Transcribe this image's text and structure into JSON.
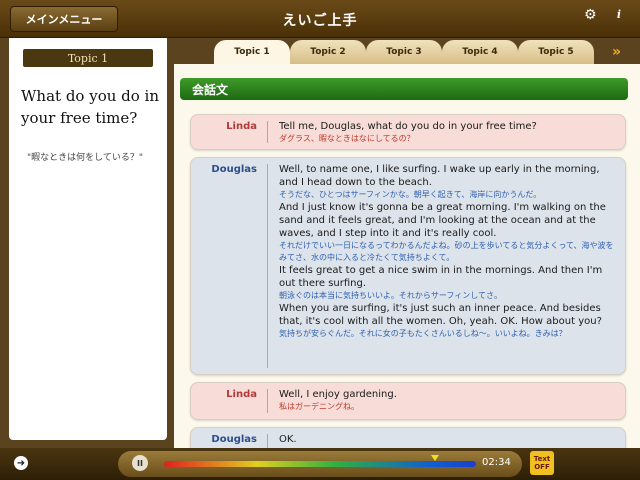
{
  "header": {
    "menu_label": "メインメニュー",
    "app_title": "えいご上手"
  },
  "topic": {
    "label": "Topic 1",
    "question": "What do you do in your free time?",
    "translation": "\"暇なときは何をしている？\""
  },
  "tabs": [
    {
      "label": "Topic 1",
      "active": true
    },
    {
      "label": "Topic 2",
      "active": false
    },
    {
      "label": "Topic 3",
      "active": false
    },
    {
      "label": "Topic 4",
      "active": false
    },
    {
      "label": "Topic 5",
      "active": false
    }
  ],
  "tabs_next_label": "»",
  "section_title": "会話文",
  "dialogue": [
    {
      "speaker": "Linda",
      "lines": [
        {
          "en": "Tell me, Douglas, what do you do in your free time?"
        },
        {
          "ja": "ダグラス、暇なときはなにしてるの？"
        }
      ]
    },
    {
      "speaker": "Douglas",
      "lines": [
        {
          "en": "Well, to name one, I like surfing. I wake up early in the morning, and I head down to the beach."
        },
        {
          "ja": "そうだな、ひとつはサーフィンかな。朝早く起きて、海岸に向かうんだ。"
        },
        {
          "en": "And I just know it's gonna be a great morning. I'm walking on the sand and it feels great, and I'm looking at the ocean and at the waves, and I step into it and it's really cool."
        },
        {
          "ja": "それだけでいい一日になるってわかるんだよね。砂の上を歩いてると気分よくって、海や波をみてさ、水の中に入ると冷たくて気持ちよくて。"
        },
        {
          "en": "It feels great to get a nice swim in in the mornings. And then I'm out there surfing."
        },
        {
          "ja": "朝泳ぐのは本当に気持ちいいよ。それからサーフィンしてさ。"
        },
        {
          "en": "When you are surfing, it's just such an inner peace. And besides that, it's cool with all the women. Oh, yeah. OK. How about you?"
        },
        {
          "ja": "気持ちが安らぐんだ。それに女の子もたくさんいるしね〜。いいよね。きみは？"
        }
      ]
    },
    {
      "speaker": "Linda",
      "lines": [
        {
          "en": "Well, I enjoy gardening."
        },
        {
          "ja": "私はガーデニングね。"
        }
      ]
    },
    {
      "speaker": "Douglas",
      "lines": [
        {
          "en": "OK."
        }
      ]
    }
  ],
  "player": {
    "pause_label": "II",
    "time": "02:34",
    "progress": 0.87,
    "text_toggle_line1": "Text",
    "text_toggle_line2": "OFF"
  },
  "icons": {
    "settings": "gear-icon",
    "info": "info-icon",
    "back": "arrow-right-circle-icon"
  }
}
